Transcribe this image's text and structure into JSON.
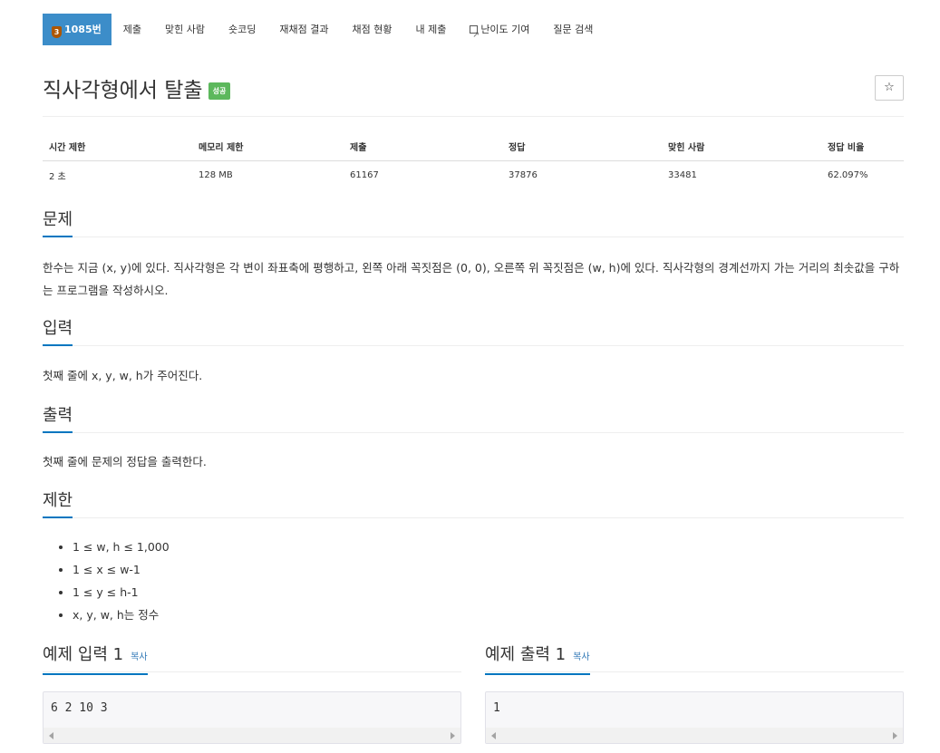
{
  "nav": {
    "tier": "3",
    "problem_id": "1085번",
    "items": [
      "제출",
      "맞힌 사람",
      "숏코딩",
      "재채점 결과",
      "채점 현황",
      "내 제출",
      "난이도 기여",
      "질문 검색"
    ]
  },
  "title": "직사각형에서 탈출",
  "badge": "성공",
  "star": "☆",
  "info": {
    "headers": [
      "시간 제한",
      "메모리 제한",
      "제출",
      "정답",
      "맞힌 사람",
      "정답 비율"
    ],
    "values": [
      "2 초",
      "128 MB",
      "61167",
      "37876",
      "33481",
      "62.097%"
    ]
  },
  "sections": {
    "problem": {
      "title": "문제",
      "text": "한수는 지금 (x, y)에 있다. 직사각형은 각 변이 좌표축에 평행하고, 왼쪽 아래 꼭짓점은 (0, 0), 오른쪽 위 꼭짓점은 (w, h)에 있다. 직사각형의 경계선까지 가는 거리의 최솟값을 구하는 프로그램을 작성하시오."
    },
    "input": {
      "title": "입력",
      "text": "첫째 줄에 x, y, w, h가 주어진다."
    },
    "output": {
      "title": "출력",
      "text": "첫째 줄에 문제의 정답을 출력한다."
    },
    "limits": {
      "title": "제한",
      "items": [
        "1 ≤ w, h ≤ 1,000",
        "1 ≤ x ≤ w-1",
        "1 ≤ y ≤ h-1",
        "x, y, w, h는 정수"
      ]
    }
  },
  "examples": {
    "input_title": "예제 입력 1",
    "output_title": "예제 출력 1",
    "copy_label": "복사",
    "input_value": "6 2 10 3",
    "output_value": "1"
  }
}
